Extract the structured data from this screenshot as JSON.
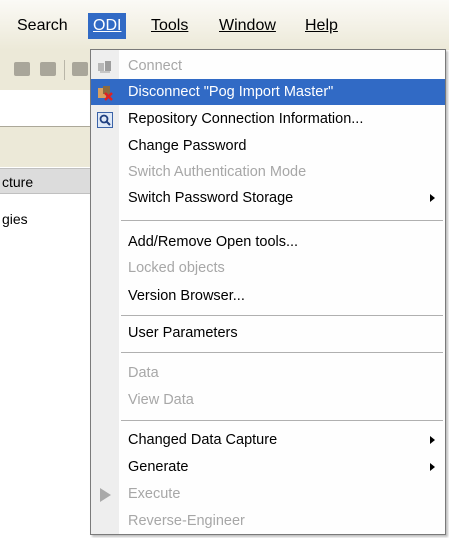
{
  "menubar": {
    "items": [
      {
        "label": "Search",
        "mnemonic": ""
      },
      {
        "label": "ODI",
        "mnemonic": "O"
      },
      {
        "label": "Tools",
        "mnemonic": "T"
      },
      {
        "label": "Window",
        "mnemonic": "W"
      },
      {
        "label": "Help",
        "mnemonic": "H"
      }
    ],
    "active_index": 1
  },
  "background": {
    "tree_items": [
      "cture",
      "gies"
    ]
  },
  "menu": {
    "items": [
      {
        "label": "Connect",
        "enabled": false,
        "icon": "connect-icon"
      },
      {
        "label": "Disconnect \"Pog Import Master\"",
        "enabled": true,
        "icon": "disconnect-icon",
        "highlighted": true
      },
      {
        "label": "Repository Connection Information...",
        "enabled": true,
        "icon": "repository-info-icon"
      },
      {
        "label": "Change Password",
        "enabled": true
      },
      {
        "label": "Switch Authentication Mode",
        "enabled": false
      },
      {
        "label": "Switch Password Storage",
        "enabled": true,
        "submenu": true
      },
      {
        "label": "Add/Remove Open tools...",
        "enabled": true
      },
      {
        "label": "Locked objects",
        "enabled": false
      },
      {
        "label": "Version Browser...",
        "enabled": true
      },
      {
        "label": "User Parameters",
        "enabled": true
      },
      {
        "label": "Data",
        "enabled": false
      },
      {
        "label": "View Data",
        "enabled": false
      },
      {
        "label": "Changed Data Capture",
        "enabled": true,
        "submenu": true
      },
      {
        "label": "Generate",
        "enabled": true,
        "submenu": true
      },
      {
        "label": "Execute",
        "enabled": false,
        "icon": "execute-icon"
      },
      {
        "label": "Reverse-Engineer",
        "enabled": false
      }
    ]
  },
  "colors": {
    "highlight": "#316ac5",
    "disabled_text": "#a7a7a7",
    "menubar_bg": "#ece9d8"
  }
}
